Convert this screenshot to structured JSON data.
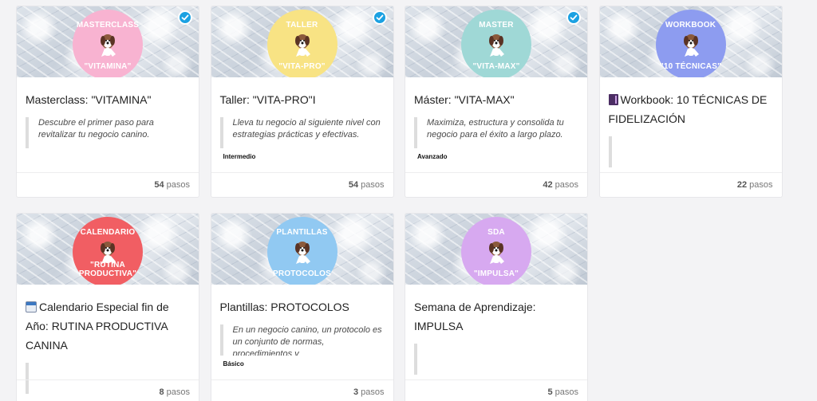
{
  "cards": [
    {
      "title": "Masterclass: \"VITAMINA\"",
      "badge_top": "MASTERCLASS",
      "badge_bottom": "\"VITAMINA\"",
      "excerpt": "Descubre el primer paso para revitalizar tu negocio canino.",
      "level": "",
      "steps_number": "54",
      "steps_label": "pasos",
      "completed_icon": "check-circle-icon",
      "badge_color": "#f8b3d1"
    },
    {
      "title": "Taller: \"VITA-PRO\"I",
      "badge_top": "TALLER",
      "badge_bottom": "\"VITA-PRO\"",
      "excerpt": "Lleva tu negocio al siguiente nivel con estrategias prácticas y efectivas.",
      "level": "Intermedio",
      "steps_number": "54",
      "steps_label": "pasos",
      "completed_icon": "check-circle-icon",
      "badge_color": "#f8e384"
    },
    {
      "title": "Máster: \"VITA-MAX\"",
      "badge_top": "MASTER",
      "badge_bottom": "\"VITA-MAX\"",
      "excerpt": "Maximiza, estructura y consolida tu negocio para el éxito a largo plazo.",
      "level": "Avanzado",
      "steps_number": "42",
      "steps_label": "pasos",
      "completed_icon": "check-circle-icon",
      "badge_color": "#9fd8d6"
    },
    {
      "title": "Workbook: 10 TÉCNICAS DE FIDELIZACIÓN",
      "badge_top": "WORKBOOK",
      "badge_bottom": "\"10 TÉCNICAS\"",
      "excerpt": "",
      "level": "",
      "steps_number": "22",
      "steps_label": "pasos",
      "title_icon": "book-icon",
      "badge_color": "#8d9cf0"
    },
    {
      "title": "Calendario Especial fin de Año: RUTINA PRODUCTIVA CANINA",
      "badge_top": "CALENDARIO",
      "badge_bottom": "\"RUTINA PRODUCTIVA\"",
      "excerpt": "",
      "level": "",
      "steps_number": "8",
      "steps_label": "pasos",
      "title_icon": "calendar-icon",
      "badge_color": "#f15e63"
    },
    {
      "title": "Plantillas: PROTOCOLOS",
      "badge_top": "PLANTILLAS",
      "badge_bottom": "PROTOCOLOS",
      "excerpt": "En un negocio canino, un protocolo es un conjunto de normas, procedimientos y",
      "level": "Básico",
      "steps_number": "3",
      "steps_label": "pasos",
      "badge_color": "#91c9f2"
    },
    {
      "title": "Semana de Aprendizaje: IMPULSA",
      "badge_top": "SDA",
      "badge_bottom": "\"IMPULSA\"",
      "excerpt": "",
      "level": "",
      "steps_number": "5",
      "steps_label": "pasos",
      "badge_color": "#d7a9f0"
    }
  ]
}
